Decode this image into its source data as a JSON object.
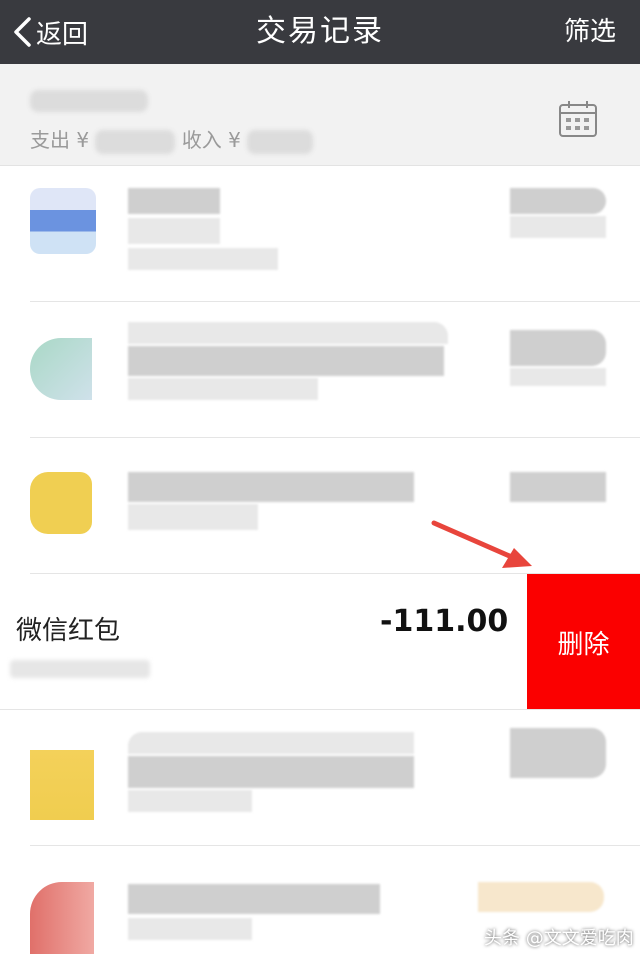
{
  "nav": {
    "back_label": "返回",
    "title": "交易记录",
    "filter_label": "筛选"
  },
  "summary": {
    "expense_label": "支出 ¥",
    "income_label": "收入 ¥"
  },
  "record": {
    "title": "微信红包",
    "amount": "-111.00",
    "delete_label": "删除"
  },
  "colors": {
    "nav_bg": "#393a3f",
    "delete_bg": "#fb0000",
    "arrow": "#e8453c"
  },
  "watermark": "头条 @文文爱吃肉"
}
